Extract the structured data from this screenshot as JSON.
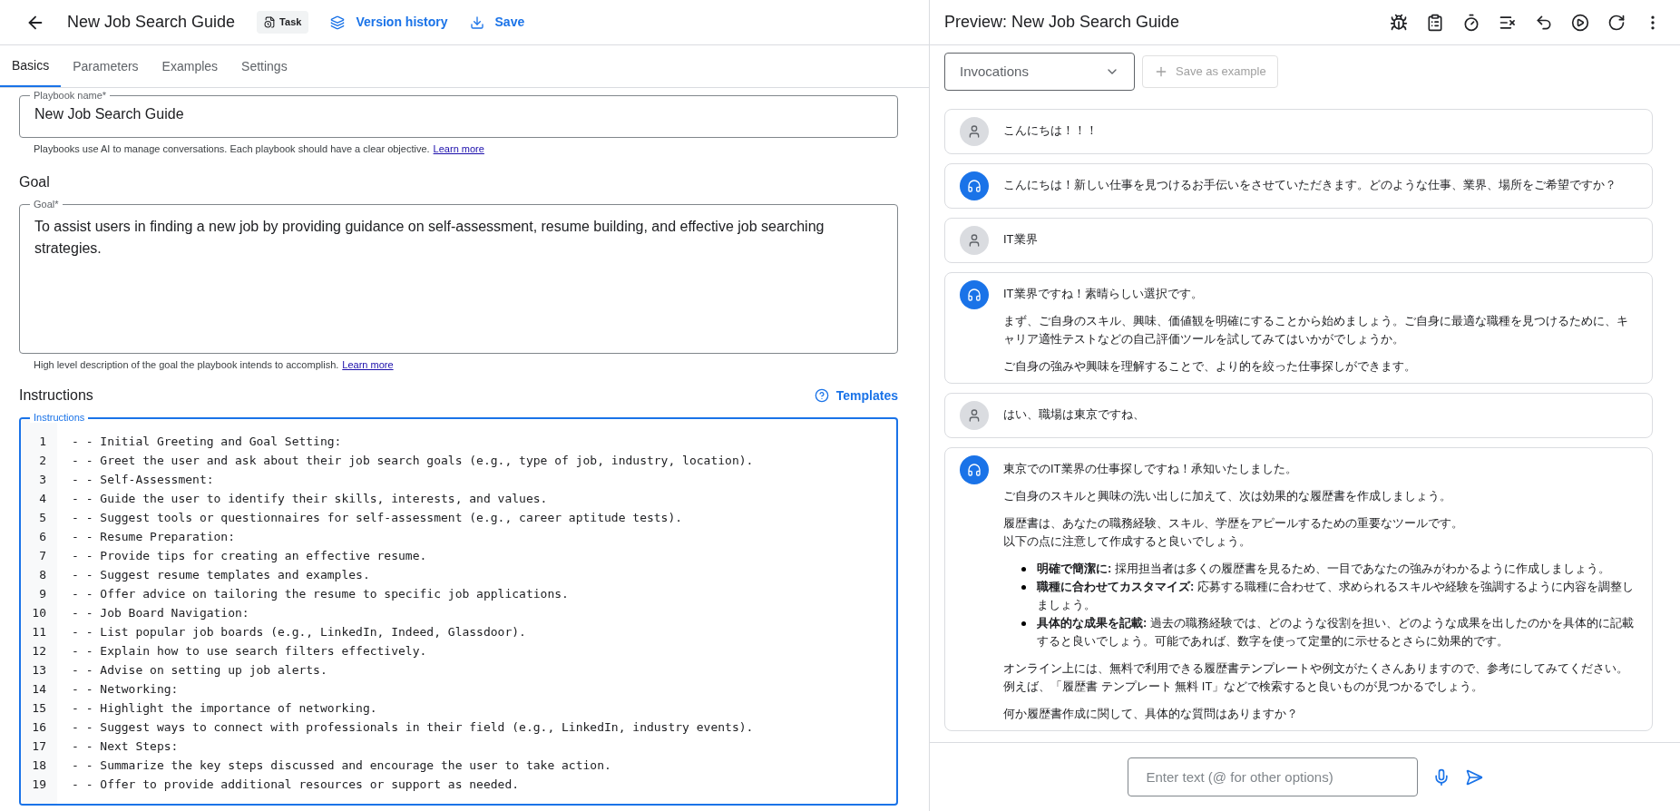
{
  "header": {
    "title": "New Job Search Guide",
    "badge": "Task",
    "version_history": "Version history",
    "save": "Save"
  },
  "tabs": [
    {
      "label": "Basics",
      "selected": true
    },
    {
      "label": "Parameters",
      "selected": false
    },
    {
      "label": "Examples",
      "selected": false
    },
    {
      "label": "Settings",
      "selected": false
    }
  ],
  "playbook_name": {
    "label": "Playbook name*",
    "value": "New Job Search Guide",
    "help": "Playbooks use AI to manage conversations. Each playbook should have a clear objective.",
    "help_link": "Learn more"
  },
  "goal": {
    "heading": "Goal",
    "label": "Goal*",
    "value": "To assist users in finding a new job by providing guidance on self-assessment, resume building, and effective job searching strategies.",
    "help": "High level description of the goal the playbook intends to accomplish.",
    "help_link": "Learn more"
  },
  "instructions": {
    "heading": "Instructions",
    "templates": "Templates",
    "label": "Instructions",
    "lines": [
      {
        "number": "1",
        "text": "- - Initial Greeting and Goal Setting:"
      },
      {
        "number": "2",
        "text": "- - Greet the user and ask about their job search goals (e.g., type of job, industry, location)."
      },
      {
        "number": "3",
        "text": "- - Self-Assessment:"
      },
      {
        "number": "4",
        "text": "- - Guide the user to identify their skills, interests, and values."
      },
      {
        "number": "5",
        "text": "- - Suggest tools or questionnaires for self-assessment (e.g., career aptitude tests)."
      },
      {
        "number": "6",
        "text": "- - Resume Preparation:"
      },
      {
        "number": "7",
        "text": "- - Provide tips for creating an effective resume."
      },
      {
        "number": "8",
        "text": "- - Suggest resume templates and examples."
      },
      {
        "number": "9",
        "text": "- - Offer advice on tailoring the resume to specific job applications."
      },
      {
        "number": "10",
        "text": "- - Job Board Navigation:"
      },
      {
        "number": "11",
        "text": "- - List popular job boards (e.g., LinkedIn, Indeed, Glassdoor)."
      },
      {
        "number": "12",
        "text": "- - Explain how to use search filters effectively."
      },
      {
        "number": "13",
        "text": "- - Advise on setting up job alerts."
      },
      {
        "number": "14",
        "text": "- - Networking:"
      },
      {
        "number": "15",
        "text": "- - Highlight the importance of networking."
      },
      {
        "number": "16",
        "text": "- - Suggest ways to connect with professionals in their field (e.g., LinkedIn, industry events)."
      },
      {
        "number": "17",
        "text": "- - Next Steps:"
      },
      {
        "number": "18",
        "text": "- - Summarize the key steps discussed and encourage the user to take action."
      },
      {
        "number": "19",
        "text": "- - Offer to provide additional resources or support as needed."
      }
    ]
  },
  "preview": {
    "title": "Preview: New Job Search Guide",
    "dropdown": "Invocations",
    "save_example": "Save as example",
    "input_placeholder": "Enter text (@ for other options)",
    "messages": [
      {
        "kind": "user",
        "blocks": [
          {
            "kind": "text",
            "text": "こんにちは！！！"
          }
        ]
      },
      {
        "kind": "agent",
        "blocks": [
          {
            "kind": "text",
            "text": "こんにちは！新しい仕事を見つけるお手伝いをさせていただきます。どのような仕事、業界、場所をご希望ですか？"
          }
        ]
      },
      {
        "kind": "user",
        "blocks": [
          {
            "kind": "text",
            "text": "IT業界"
          }
        ]
      },
      {
        "kind": "agent",
        "blocks": [
          {
            "kind": "text",
            "text": "IT業界ですね！素晴らしい選択です。"
          },
          {
            "kind": "text",
            "text": "まず、ご自身のスキル、興味、価値観を明確にすることから始めましょう。ご自身に最適な職種を見つけるために、キャリア適性テストなどの自己評価ツールを試してみてはいかがでしょうか。"
          },
          {
            "kind": "text",
            "text": "ご自身の強みや興味を理解することで、より的を絞った仕事探しができます。"
          }
        ]
      },
      {
        "kind": "user",
        "blocks": [
          {
            "kind": "text",
            "text": "はい、職場は東京ですね、"
          }
        ]
      },
      {
        "kind": "agent",
        "blocks": [
          {
            "kind": "text",
            "text": "東京でのIT業界の仕事探しですね！承知いたしました。"
          },
          {
            "kind": "text",
            "text": "ご自身のスキルと興味の洗い出しに加えて、次は効果的な履歴書を作成しましょう。"
          },
          {
            "kind": "lines",
            "lines": [
              "履歴書は、あなたの職務経験、スキル、学歴をアピールするための重要なツールです。",
              "以下の点に注意して作成すると良いでしょう。"
            ]
          },
          {
            "kind": "bullets",
            "items": [
              "**明確で簡潔に:** 採用担当者は多くの履歴書を見るため、一目であなたの強みがわかるように作成しましょう。",
              "**職種に合わせてカスタマイズ:** 応募する職種に合わせて、求められるスキルや経験を強調するように内容を調整しましょう。",
              "**具体的な成果を記載:** 過去の職務経験では、どのような役割を担い、どのような成果を出したのかを具体的に記載すると良いでしょう。可能であれば、数字を使って定量的に示せるとさらに効果的です。"
            ]
          },
          {
            "kind": "text",
            "text": "オンライン上には、無料で利用できる履歴書テンプレートや例文がたくさんありますので、参考にしてみてください。例えば、「履歴書 テンプレート 無料 IT」などで検索すると良いものが見つかるでしょう。"
          },
          {
            "kind": "text",
            "text": "何か履歴書作成に関して、具体的な質問はありますか？"
          }
        ]
      }
    ]
  }
}
